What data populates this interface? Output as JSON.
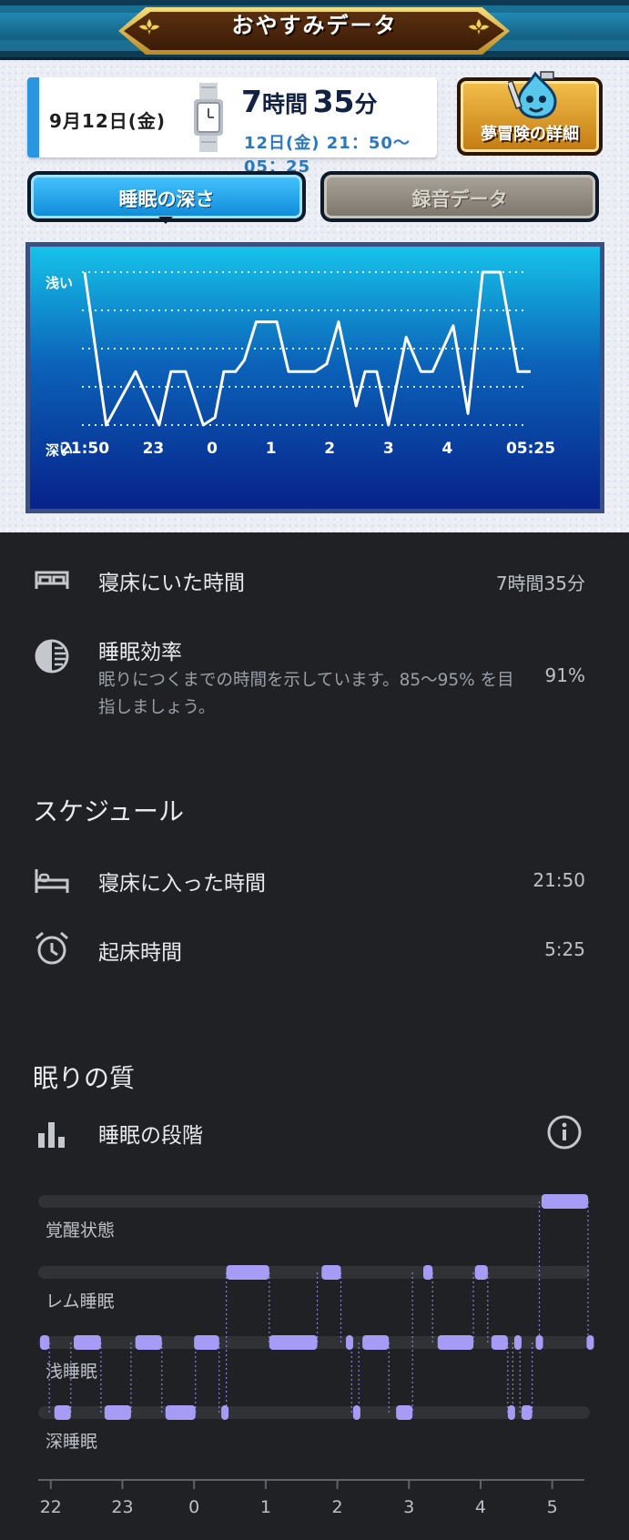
{
  "header": {
    "title": "おやすみデータ"
  },
  "date_card": {
    "date": "9月12日(金)",
    "duration_hours": "7",
    "duration_hours_unit": "時間",
    "duration_minutes": "35",
    "duration_minutes_unit": "分",
    "range": "12日(金) 21：50～05：25"
  },
  "detail_button": {
    "label": "夢冒険の詳細"
  },
  "tabs": [
    {
      "label": "睡眠の深さ",
      "active": true
    },
    {
      "label": "録音データ",
      "active": false
    }
  ],
  "colors": {
    "tab_active": "#1a9be6",
    "chart_top": "#0fb0e0",
    "chart_bottom": "#0a2f8c",
    "stage_purple": "#a79cf5",
    "dark_bg": "#202124"
  },
  "chart_data": [
    {
      "type": "line",
      "y_top_label": "浅い",
      "y_bottom_label": "深い",
      "x_tick_labels": [
        "21:50",
        "23",
        "0",
        "1",
        "2",
        "3",
        "4",
        "05:25"
      ],
      "x_ticks_hours": [
        21.833,
        23,
        24,
        25,
        26,
        27,
        28,
        29.417
      ],
      "xlim_hours": [
        21.833,
        29.417
      ],
      "ylim": [
        0,
        4
      ],
      "levels": 5,
      "grid": true,
      "points": [
        [
          21.833,
          4
        ],
        [
          22.2,
          0
        ],
        [
          22.7,
          1.4
        ],
        [
          23.1,
          0
        ],
        [
          23.3,
          1.4
        ],
        [
          23.55,
          1.4
        ],
        [
          23.85,
          0
        ],
        [
          24.05,
          0.2
        ],
        [
          24.2,
          1.4
        ],
        [
          24.4,
          1.4
        ],
        [
          24.55,
          1.7
        ],
        [
          24.75,
          2.7
        ],
        [
          25.1,
          2.7
        ],
        [
          25.3,
          1.4
        ],
        [
          25.75,
          1.4
        ],
        [
          25.95,
          1.6
        ],
        [
          26.15,
          2.7
        ],
        [
          26.45,
          0.5
        ],
        [
          26.6,
          1.4
        ],
        [
          26.8,
          1.4
        ],
        [
          27.0,
          0
        ],
        [
          27.3,
          2.3
        ],
        [
          27.55,
          1.4
        ],
        [
          27.75,
          1.4
        ],
        [
          28.1,
          2.6
        ],
        [
          28.35,
          0.3
        ],
        [
          28.6,
          4
        ],
        [
          28.9,
          4
        ],
        [
          29.2,
          1.4
        ],
        [
          29.417,
          1.4
        ]
      ]
    },
    {
      "type": "timeline",
      "stage_labels": [
        "覚醒状態",
        "レム睡眠",
        "浅睡眠",
        "深睡眠"
      ],
      "x_tick_labels": [
        "22",
        "23",
        "0",
        "1",
        "2",
        "3",
        "4",
        "5"
      ],
      "x_ticks_hours": [
        22,
        23,
        24,
        25,
        26,
        27,
        28,
        29
      ],
      "xlim_hours": [
        21.85,
        29.5
      ],
      "segments": [
        {
          "stage": 2,
          "start": 21.85,
          "end": 21.98
        },
        {
          "stage": 3,
          "start": 22.05,
          "end": 22.28
        },
        {
          "stage": 2,
          "start": 22.32,
          "end": 22.7
        },
        {
          "stage": 3,
          "start": 22.75,
          "end": 23.12
        },
        {
          "stage": 2,
          "start": 23.18,
          "end": 23.55
        },
        {
          "stage": 3,
          "start": 23.6,
          "end": 24.02
        },
        {
          "stage": 2,
          "start": 24.0,
          "end": 24.35
        },
        {
          "stage": 3,
          "start": 24.38,
          "end": 24.45
        },
        {
          "stage": 1,
          "start": 24.45,
          "end": 25.05
        },
        {
          "stage": 2,
          "start": 25.05,
          "end": 25.72
        },
        {
          "stage": 1,
          "start": 25.78,
          "end": 26.05
        },
        {
          "stage": 2,
          "start": 26.12,
          "end": 26.2
        },
        {
          "stage": 3,
          "start": 26.22,
          "end": 26.3
        },
        {
          "stage": 2,
          "start": 26.35,
          "end": 26.72
        },
        {
          "stage": 3,
          "start": 26.82,
          "end": 27.05
        },
        {
          "stage": 1,
          "start": 27.2,
          "end": 27.33
        },
        {
          "stage": 2,
          "start": 27.4,
          "end": 27.9
        },
        {
          "stage": 1,
          "start": 27.92,
          "end": 28.1
        },
        {
          "stage": 2,
          "start": 28.15,
          "end": 28.38
        },
        {
          "stage": 3,
          "start": 28.38,
          "end": 28.45
        },
        {
          "stage": 2,
          "start": 28.47,
          "end": 28.55
        },
        {
          "stage": 3,
          "start": 28.57,
          "end": 28.72
        },
        {
          "stage": 2,
          "start": 28.77,
          "end": 28.82
        },
        {
          "stage": 0,
          "start": 28.85,
          "end": 29.5
        },
        {
          "stage": 2,
          "start": 29.48,
          "end": 29.5
        }
      ]
    }
  ],
  "metrics": {
    "time_in_bed": {
      "label": "寝床にいた時間",
      "value": "7時間35分",
      "icon": "bed-icon"
    },
    "sleep_efficiency": {
      "label": "睡眠効率",
      "value": "91%",
      "description": "眠りにつくまでの時間を示しています。85～95% を目指しましょう。",
      "icon": "half-circle-icon"
    }
  },
  "schedule": {
    "title": "スケジュール",
    "bedtime": {
      "label": "寝床に入った時間",
      "value": "21:50",
      "icon": "bed-time-icon"
    },
    "wake": {
      "label": "起床時間",
      "value": "5:25",
      "icon": "alarm-clock-icon"
    }
  },
  "quality": {
    "title": "眠りの質",
    "stages": {
      "label": "睡眠の段階",
      "icon": "bar-chart-icon",
      "info_icon": "info-icon"
    }
  }
}
